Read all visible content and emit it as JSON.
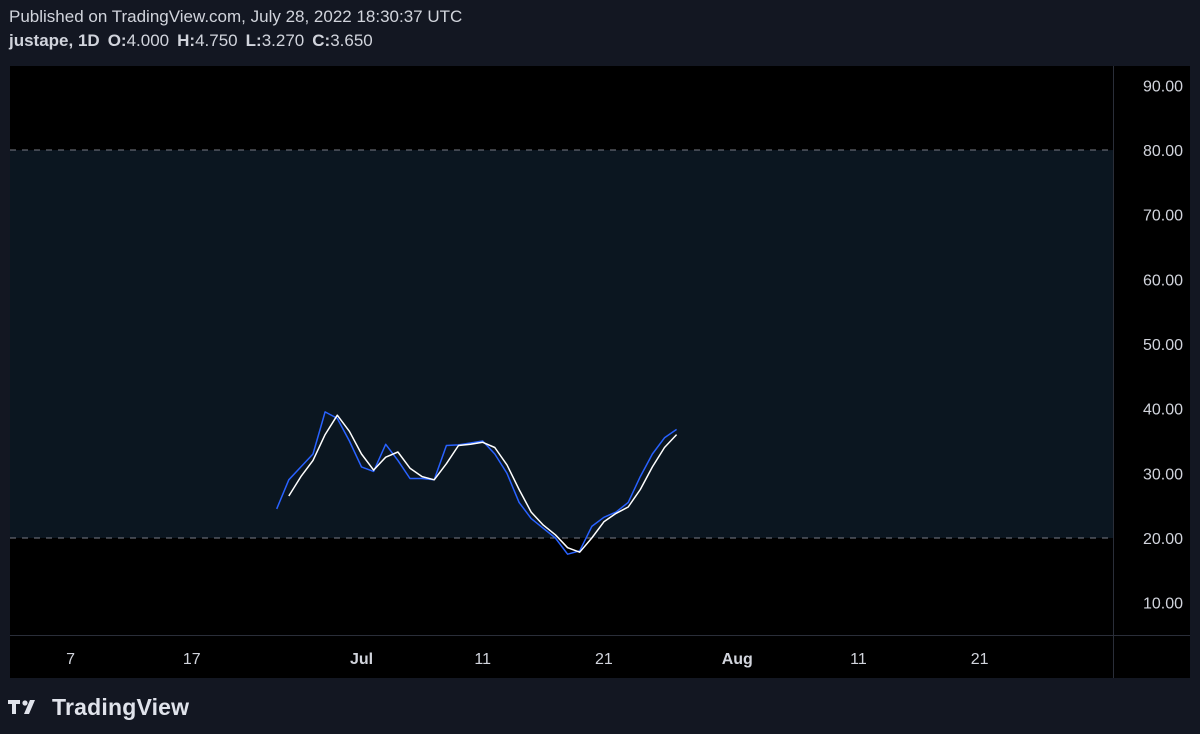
{
  "header": {
    "published": "Published on TradingView.com, July 28, 2022 18:30:37 UTC",
    "symbol": "justape, 1D",
    "o_label": "O:",
    "o_value": "4.000",
    "h_label": "H:",
    "h_value": "4.750",
    "l_label": "L:",
    "l_value": "3.270",
    "c_label": "C:",
    "c_value": "3.650"
  },
  "footer": {
    "brand": "TradingView"
  },
  "colors": {
    "background": "#131722",
    "pane": "#000000",
    "band": "#0b1620",
    "k_line": "#2962ff",
    "d_line": "#ffffff",
    "band_line": "#787b86"
  },
  "chart_data": {
    "type": "line",
    "x_axis": {
      "range": [
        "2022-06-02",
        "2022-09-01"
      ],
      "ticks": [
        {
          "date": "2022-06-07",
          "label": "7",
          "bold": false
        },
        {
          "date": "2022-06-17",
          "label": "17",
          "bold": false
        },
        {
          "date": "2022-07-01",
          "label": "Jul",
          "bold": true
        },
        {
          "date": "2022-07-11",
          "label": "11",
          "bold": false
        },
        {
          "date": "2022-07-21",
          "label": "21",
          "bold": false
        },
        {
          "date": "2022-08-01",
          "label": "Aug",
          "bold": true
        },
        {
          "date": "2022-08-11",
          "label": "11",
          "bold": false
        },
        {
          "date": "2022-08-21",
          "label": "21",
          "bold": false
        }
      ]
    },
    "y_axis": {
      "range": [
        5,
        93
      ],
      "ticks": [
        "10.00",
        "20.00",
        "30.00",
        "40.00",
        "50.00",
        "60.00",
        "70.00",
        "80.00",
        "90.00"
      ]
    },
    "bands": {
      "upper": 80,
      "lower": 20
    },
    "series": [
      {
        "key": "k",
        "color": "#2962ff",
        "points": [
          [
            "2022-06-24",
            24.5
          ],
          [
            "2022-06-25",
            29.0
          ],
          [
            "2022-06-26",
            31.0
          ],
          [
            "2022-06-27",
            33.0
          ],
          [
            "2022-06-28",
            39.5
          ],
          [
            "2022-06-29",
            38.5
          ],
          [
            "2022-06-30",
            35.0
          ],
          [
            "2022-07-01",
            31.0
          ],
          [
            "2022-07-02",
            30.3
          ],
          [
            "2022-07-03",
            34.5
          ],
          [
            "2022-07-04",
            32.0
          ],
          [
            "2022-07-05",
            29.2
          ],
          [
            "2022-07-06",
            29.2
          ],
          [
            "2022-07-07",
            29.0
          ],
          [
            "2022-07-08",
            34.3
          ],
          [
            "2022-07-09",
            34.4
          ],
          [
            "2022-07-10",
            34.7
          ],
          [
            "2022-07-11",
            35.0
          ],
          [
            "2022-07-12",
            33.0
          ],
          [
            "2022-07-13",
            30.0
          ],
          [
            "2022-07-14",
            25.5
          ],
          [
            "2022-07-15",
            23.0
          ],
          [
            "2022-07-16",
            21.5
          ],
          [
            "2022-07-17",
            20.0
          ],
          [
            "2022-07-18",
            17.5
          ],
          [
            "2022-07-19",
            18.0
          ],
          [
            "2022-07-20",
            21.8
          ],
          [
            "2022-07-21",
            23.2
          ],
          [
            "2022-07-22",
            24.0
          ],
          [
            "2022-07-23",
            25.5
          ],
          [
            "2022-07-24",
            29.5
          ],
          [
            "2022-07-25",
            33.0
          ],
          [
            "2022-07-26",
            35.5
          ],
          [
            "2022-07-27",
            36.8
          ]
        ]
      },
      {
        "key": "d",
        "color": "#ffffff",
        "points": [
          [
            "2022-06-25",
            26.5
          ],
          [
            "2022-06-26",
            29.5
          ],
          [
            "2022-06-27",
            32.0
          ],
          [
            "2022-06-28",
            36.0
          ],
          [
            "2022-06-29",
            39.0
          ],
          [
            "2022-06-30",
            36.5
          ],
          [
            "2022-07-01",
            33.0
          ],
          [
            "2022-07-02",
            30.5
          ],
          [
            "2022-07-03",
            32.5
          ],
          [
            "2022-07-04",
            33.3
          ],
          [
            "2022-07-05",
            30.8
          ],
          [
            "2022-07-06",
            29.5
          ],
          [
            "2022-07-07",
            29.0
          ],
          [
            "2022-07-08",
            31.5
          ],
          [
            "2022-07-09",
            34.3
          ],
          [
            "2022-07-10",
            34.5
          ],
          [
            "2022-07-11",
            34.8
          ],
          [
            "2022-07-12",
            34.0
          ],
          [
            "2022-07-13",
            31.3
          ],
          [
            "2022-07-14",
            27.5
          ],
          [
            "2022-07-15",
            24.0
          ],
          [
            "2022-07-16",
            22.0
          ],
          [
            "2022-07-17",
            20.5
          ],
          [
            "2022-07-18",
            18.5
          ],
          [
            "2022-07-19",
            17.8
          ],
          [
            "2022-07-20",
            20.0
          ],
          [
            "2022-07-21",
            22.5
          ],
          [
            "2022-07-22",
            23.8
          ],
          [
            "2022-07-23",
            24.8
          ],
          [
            "2022-07-24",
            27.5
          ],
          [
            "2022-07-25",
            31.0
          ],
          [
            "2022-07-26",
            34.0
          ],
          [
            "2022-07-27",
            36.0
          ]
        ]
      }
    ]
  }
}
